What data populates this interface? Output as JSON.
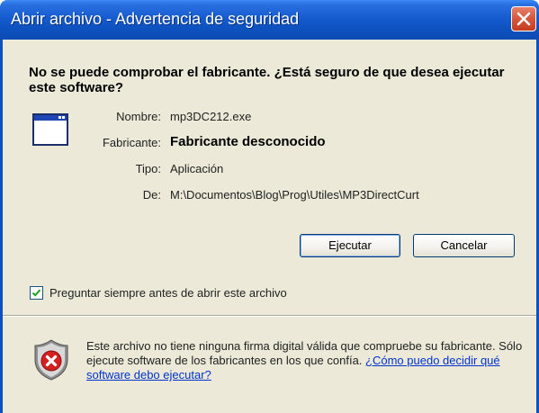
{
  "window": {
    "title": "Abrir archivo - Advertencia de seguridad",
    "close_icon": "close-icon"
  },
  "question": "No se puede comprobar el fabricante. ¿Está seguro de que desea ejecutar este software?",
  "file_info": {
    "icon": "application-window-icon",
    "name_label": "Nombre:",
    "name_value": "mp3DC212.exe",
    "publisher_label": "Fabricante:",
    "publisher_value": "Fabricante desconocido",
    "type_label": "Tipo:",
    "type_value": "Aplicación",
    "from_label": "De:",
    "from_value": "M:\\Documentos\\Blog\\Prog\\Utiles\\MP3DirectCurt"
  },
  "buttons": {
    "run": "Ejecutar",
    "cancel": "Cancelar"
  },
  "checkbox": {
    "label": "Preguntar siempre antes de abrir este archivo",
    "checked": true
  },
  "warning": {
    "icon": "shield-error-icon",
    "text": "Este archivo no tiene ninguna firma digital válida que compruebe su fabricante.  Sólo ejecute software de los fabricantes en los que confía.",
    "link": "¿Cómo puedo decidir qué software debo ejecutar?"
  },
  "colors": {
    "titlebar": "#0d50bf",
    "dialog_background": "#ece9d8",
    "close_button": "#d55a3f",
    "link": "#0033cc"
  }
}
